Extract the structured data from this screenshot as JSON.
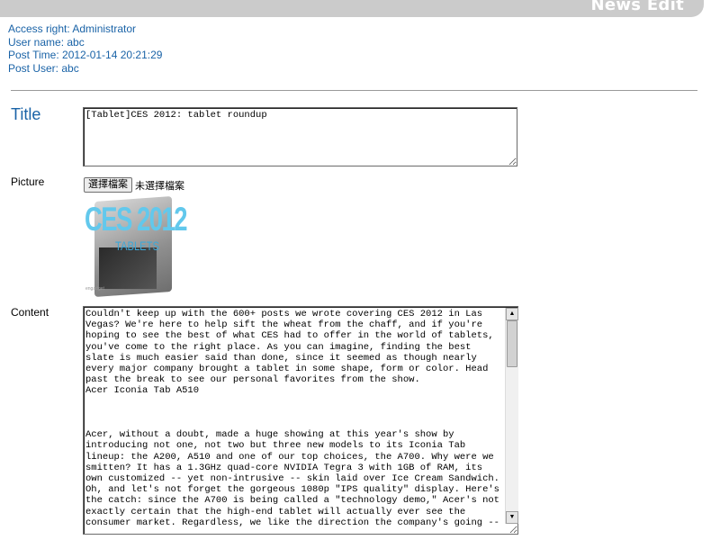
{
  "header": {
    "title": "News Edit"
  },
  "meta": {
    "access_right": "Access right: Administrator",
    "user_name": "User name: abc",
    "post_time": "Post Time: 2012-01-14 20:21:29",
    "post_user": "Post User: abc"
  },
  "form": {
    "title_label": "Title",
    "title_value": "[Tablet]CES 2012: tablet roundup",
    "picture_label": "Picture",
    "file_button": "選擇檔案",
    "file_status": "未選擇檔案",
    "picture": {
      "headline": "CES 2012",
      "subline": "TABLETS",
      "credit": "engadget"
    },
    "content_label": "Content",
    "content_value": "Couldn't keep up with the 600+ posts we wrote covering CES 2012 in Las Vegas? We're here to help sift the wheat from the chaff, and if you're hoping to see the best of what CES had to offer in the world of tablets, you've come to the right place. As you can imagine, finding the best slate is much easier said than done, since it seemed as though nearly every major company brought a tablet in some shape, form or color. Head past the break to see our personal favorites from the show.\nAcer Iconia Tab A510\n\n\n\nAcer, without a doubt, made a huge showing at this year's show by introducing not one, not two but three new models to its Iconia Tab lineup: the A200, A510 and one of our top choices, the A700. Why were we smitten? It has a 1.3GHz quad-core NVIDIA Tegra 3 with 1GB of RAM, its own customized -- yet non-intrusive -- skin laid over Ice Cream Sandwich. Oh, and let's not forget the gorgeous 1080p \"IPS quality\" display. Here's the catch: since the A700 is being called a \"technology demo,\" Acer's not exactly certain that the high-end tablet will actually ever see the consumer market. Regardless, we like the direction the company's going --"
  }
}
